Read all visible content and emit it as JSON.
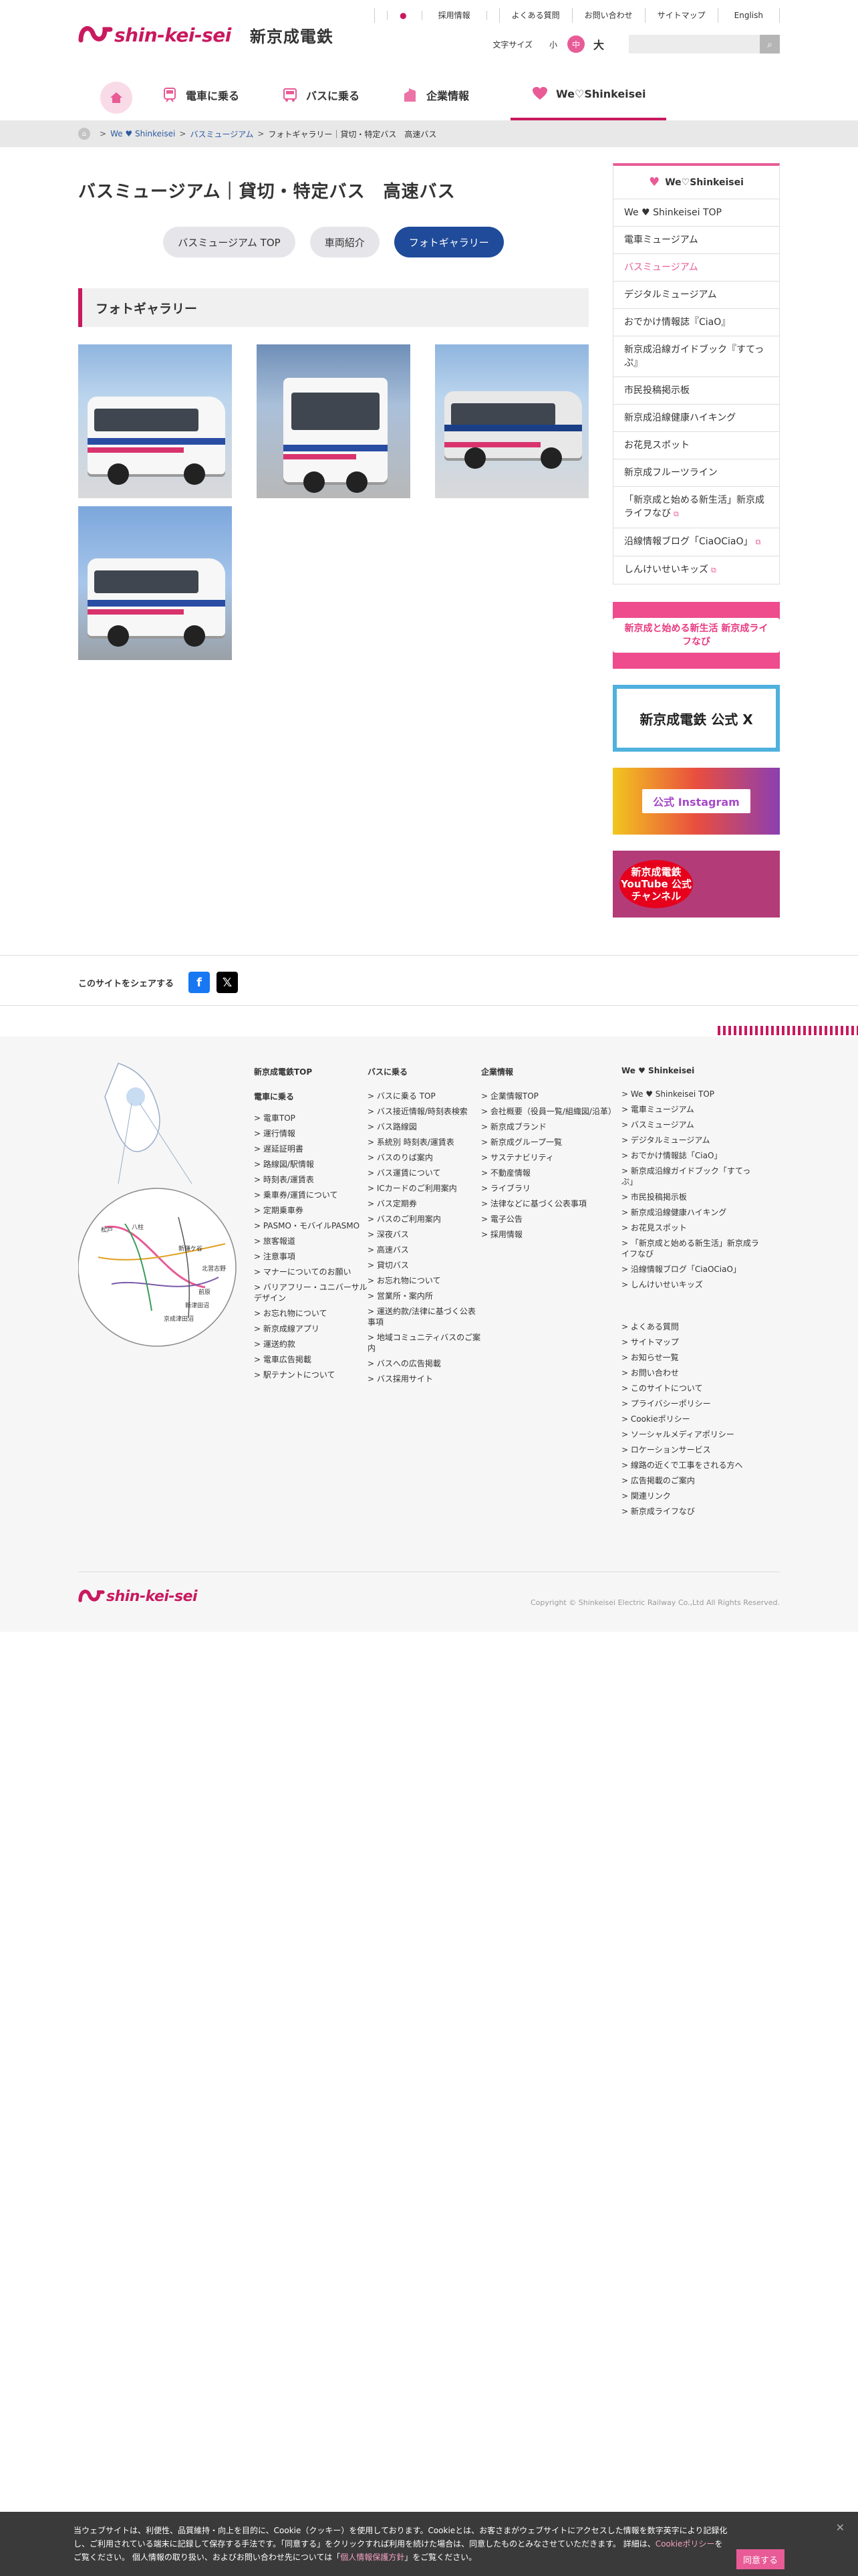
{
  "header": {
    "logo_text": "shin-kei-sei",
    "logo_jp": "新京成電鉄",
    "util_links": [
      "採用情報",
      "よくある質問",
      "お問い合わせ",
      "サイトマップ",
      "English"
    ],
    "font_size_label": "文字サイズ",
    "font_sizes": [
      "小",
      "中",
      "大"
    ],
    "search_placeholder": ""
  },
  "gnav": {
    "items": [
      {
        "label": "電車に乗る",
        "icon": "train-icon"
      },
      {
        "label": "バスに乗る",
        "icon": "bus-icon"
      },
      {
        "label": "企業情報",
        "icon": "building-icon"
      },
      {
        "label": "We♡Shinkeisei",
        "icon": "heart-icon"
      }
    ]
  },
  "breadcrumb": [
    "We ♥ Shinkeisei",
    "バスミュージアム",
    "フォトギャラリー｜貸切・特定バス　高速バス"
  ],
  "page": {
    "title": "バスミュージアム｜貸切・特定バス　高速バス",
    "tabs": [
      "バスミュージアム TOP",
      "車両紹介",
      "フォトギャラリー"
    ],
    "section_title": "フォトギャラリー"
  },
  "sidebar": {
    "title": "We♡Shinkeisei",
    "items": [
      "We ♥ Shinkeisei TOP",
      "電車ミュージアム",
      "バスミュージアム",
      "デジタルミュージアム",
      "おでかけ情報誌『CiaO』",
      "新京成沿線ガイドブック『すてっぷ』",
      "市民投稿掲示板",
      "新京成沿線健康ハイキング",
      "お花見スポット",
      "新京成フルーツライン",
      "「新京成と始める新生活」新京成ライフなび",
      "沿線情報ブログ「CiaOCiaO」",
      "しんけいせいキッズ"
    ],
    "banners": {
      "b1": "新京成と始める新生活 新京成ライフなび",
      "b2": "新京成電鉄 公式 X",
      "b3": "公式 Instagram",
      "b4": "新京成電鉄 YouTube 公式 チャンネル"
    }
  },
  "share": {
    "label": "このサイトをシェアする"
  },
  "footer": {
    "col1": {
      "title": "新京成電鉄TOP",
      "subtitle": "電車に乗る",
      "items": [
        "電車TOP",
        "運行情報",
        "遅延証明書",
        "路線図/駅情報",
        "時刻表/運賃表",
        "乗車券/運賃について",
        "定期乗車券",
        "PASMO・モバイルPASMO",
        "旅客報道",
        "注意事項",
        "マナーについてのお願い",
        "バリアフリー・ユニバーサルデザイン",
        "お忘れ物について",
        "新京成線アプリ",
        "運送約款",
        "電車広告掲載",
        "駅テナントについて"
      ]
    },
    "col2": {
      "title": "バスに乗る",
      "items": [
        "バスに乗る TOP",
        "バス接近情報/時刻表検索",
        "バス路線図",
        "系統別 時刻表/運賃表",
        "バスのりば案内",
        "バス運賃について",
        "ICカードのご利用案内",
        "バス定期券",
        "バスのご利用案内",
        "深夜バス",
        "高速バス",
        "貸切バス",
        "お忘れ物について",
        "営業所・案内所",
        "運送約款/法律に基づく公表事項",
        "地域コミュニティバスのご案内",
        "バスへの広告掲載",
        "バス採用サイト"
      ]
    },
    "col3": {
      "title": "企業情報",
      "items": [
        "企業情報TOP",
        "会社概要（役員一覧/組織図/沿革）",
        "新京成ブランド",
        "新京成グループ一覧",
        "サステナビリティ",
        "不動産情報",
        "ライブラリ",
        "法律などに基づく公表事項",
        "電子公告",
        "採用情報"
      ]
    },
    "col4": {
      "title": "We ♥ Shinkeisei",
      "items": [
        "We ♥ Shinkeisei TOP",
        "電車ミュージアム",
        "バスミュージアム",
        "デジタルミュージアム",
        "おでかけ情報誌「CiaO」",
        "新京成沿線ガイドブック「すてっぷ」",
        "市民投稿掲示板",
        "新京成沿線健康ハイキング",
        "お花見スポット",
        "「新京成と始める新生活」新京成ライフなび",
        "沿線情報ブログ「CiaOCiaO」",
        "しんけいせいキッズ"
      ],
      "items2": [
        "よくある質問",
        "サイトマップ",
        "お知らせ一覧",
        "お問い合わせ",
        "このサイトについて",
        "プライバシーポリシー",
        "Cookieポリシー",
        "ソーシャルメディアポリシー",
        "ロケーションサービス",
        "線路の近くで工事をされる方へ",
        "広告掲載のご案内",
        "関連リンク",
        "新京成ライフなび"
      ]
    },
    "map_labels": [
      "松戸",
      "八柱",
      "新鎌ケ谷",
      "北習志野",
      "前原",
      "新津田沼",
      "京成津田沼"
    ],
    "copyright": "Copyright © Shinkeisei Electric Railway Co.,Ltd All Rights Reserved."
  },
  "cookie": {
    "text1": "当ウェブサイトは、利便性、品質維持・向上を目的に、Cookie（クッキー）を使用しております。Cookieとは、お客さまがウェブサイトにアクセスした情報を数字英字により記録化し、ご利用されている端末に記録して保存する手法です。「同意する」をクリックすれば利用を続けた場合は、同意したものとみなさせていただきます。 詳細は、",
    "link1": "Cookieポリシー",
    "text2": "をご覧ください。 個人情報の取り扱い、およびお問い合わせ先については「",
    "link2": "個人情報保護方針",
    "text3": "」をご覧ください。",
    "agree": "同意する"
  }
}
